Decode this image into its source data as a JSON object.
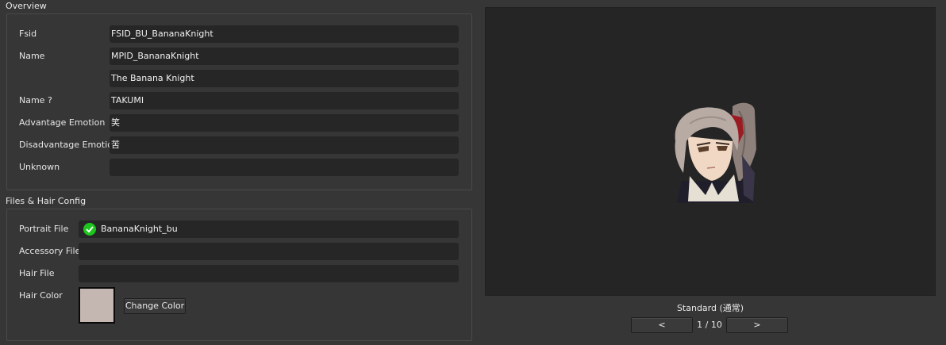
{
  "overview": {
    "title": "Overview",
    "fields": [
      {
        "label": "Fsid",
        "value": "FSID_BU_BananaKnight"
      },
      {
        "label": "Name",
        "value": "MPID_BananaKnight"
      },
      {
        "label": "",
        "value": "The Banana Knight"
      },
      {
        "label": "Name ?",
        "value": "TAKUMI"
      },
      {
        "label": "Advantage Emotion",
        "value": "笑"
      },
      {
        "label": "Disadvantage Emotion",
        "value": "苦"
      },
      {
        "label": "Unknown",
        "value": ""
      }
    ]
  },
  "files": {
    "title": "Files & Hair Config",
    "portrait": {
      "label": "Portrait File",
      "value": "BananaKnight_bu",
      "status_icon": "check-circle-icon",
      "status_color": "#1ec51e"
    },
    "accessory": {
      "label": "Accessory File",
      "value": ""
    },
    "hair": {
      "label": "Hair File",
      "value": ""
    },
    "hair_color": {
      "label": "Hair Color",
      "color": "#c4b6b1",
      "button_label": "Change Color"
    }
  },
  "preview": {
    "subject_icon": "character-portrait-icon",
    "caption": "Standard (通常)",
    "prev_label": "<",
    "next_label": ">",
    "page_indicator": "1 / 10"
  }
}
